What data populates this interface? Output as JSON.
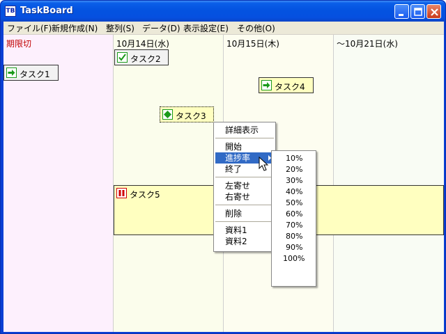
{
  "window": {
    "app_icon": "TB",
    "title": "TaskBoard",
    "buttons": [
      "minimize-icon",
      "maximize-icon",
      "close-icon"
    ]
  },
  "menubar": [
    "ファイル(F)",
    "新規作成(N)",
    "整列(S)",
    "データ(D)",
    "表示設定(E)",
    "その他(O)"
  ],
  "columns": [
    {
      "header": "期限切",
      "color": "#c00000",
      "background": "#fdf0fd"
    },
    {
      "header": "10月14日(水)",
      "background": "#fbfdec"
    },
    {
      "header": "10月15日(木)",
      "background": "#fdfdf0"
    },
    {
      "header": "〜10月21日(水)",
      "background": "#f9fcf4"
    }
  ],
  "tasks": [
    {
      "label": "タスク1",
      "icon": "arrow-right-icon"
    },
    {
      "label": "タスク2",
      "icon": "checkmark-icon"
    },
    {
      "label": "タスク3",
      "icon": "diamond-icon"
    },
    {
      "label": "タスク4",
      "icon": "arrow-right-icon"
    },
    {
      "label": "タスク5",
      "icon": "pause-icon"
    }
  ],
  "context_menu": {
    "groups": [
      [
        "詳細表示"
      ],
      [
        "開始",
        "進捗率",
        "終了"
      ],
      [
        "左寄せ",
        "右寄せ"
      ],
      [
        "削除"
      ],
      [
        "資料1",
        "資料2"
      ]
    ],
    "highlighted": "進捗率"
  },
  "progress_submenu": [
    "10%",
    "20%",
    "30%",
    "40%",
    "50%",
    "60%",
    "70%",
    "80%",
    "90%",
    "100%"
  ],
  "colors": {
    "titlebar": "#0453e0",
    "highlight": "#316ac5",
    "task_bg": "#f2f2f2",
    "task_highlight_bg": "#ffffc0",
    "icon_green": "#1a9a1a",
    "icon_red": "#d00000"
  }
}
